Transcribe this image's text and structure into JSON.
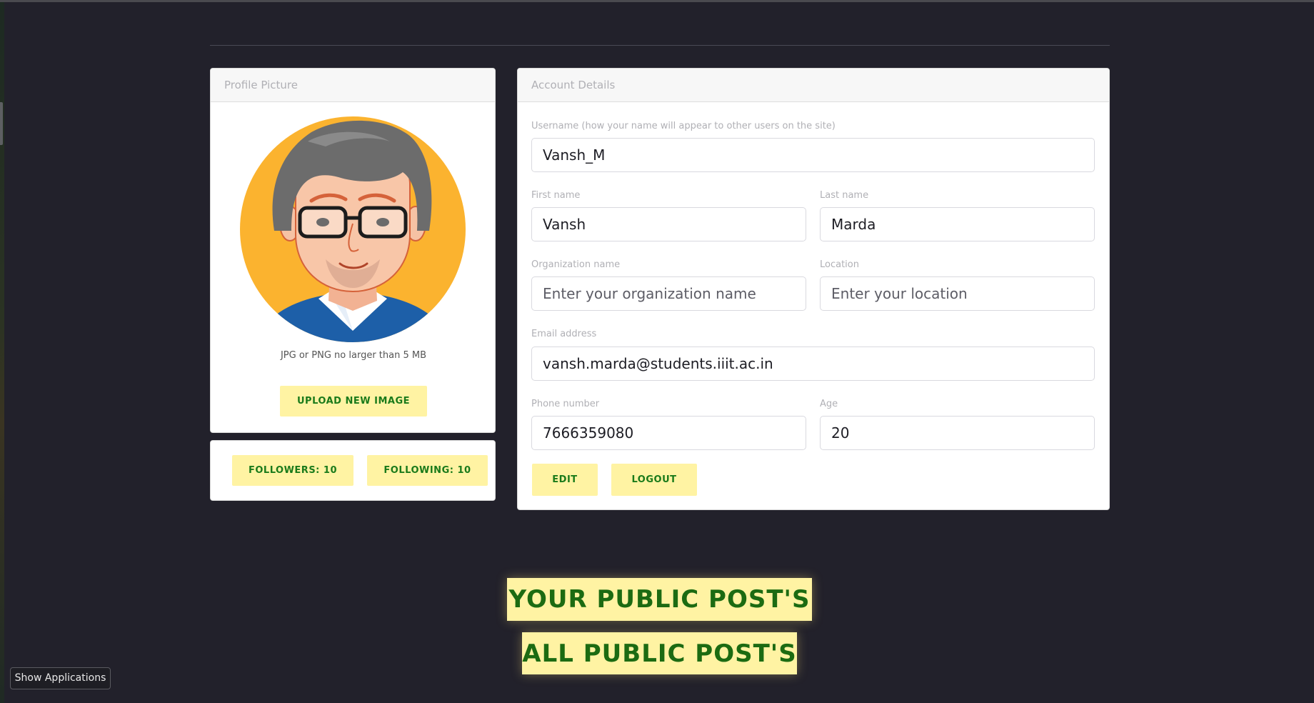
{
  "profile_card": {
    "header": "Profile Picture",
    "hint": "JPG or PNG no larger than 5 MB",
    "upload_label": "UPLOAD NEW IMAGE"
  },
  "follow": {
    "followers_label": "FOLLOWERS: 10",
    "following_label": "FOLLOWING: 10"
  },
  "account": {
    "header": "Account Details",
    "username_label": "Username (how your name will appear to other users on the site)",
    "username_value": "Vansh_M",
    "first_name_label": "First name",
    "first_name_value": "Vansh",
    "last_name_label": "Last name",
    "last_name_value": "Marda",
    "org_label": "Organization name",
    "org_placeholder": "Enter your organization name",
    "location_label": "Location",
    "location_placeholder": "Enter your location",
    "email_label": "Email address",
    "email_value": "vansh.marda@students.iiit.ac.in",
    "phone_label": "Phone number",
    "phone_value": "7666359080",
    "age_label": "Age",
    "age_value": "20",
    "edit_label": "EDIT",
    "logout_label": "LOGOUT"
  },
  "posts": {
    "your_public_label": "YOUR PUBLIC POST'S",
    "all_public_label": "ALL PUBLIC POST'S"
  },
  "system": {
    "show_applications_label": "Show Applications"
  },
  "colors": {
    "background": "#22212b",
    "button_bg": "#fff3a3",
    "button_text": "#1a7a1a",
    "avatar_bg": "#fbb32f"
  },
  "icons": {
    "avatar": "cartoon-man-with-glasses-avatar"
  }
}
